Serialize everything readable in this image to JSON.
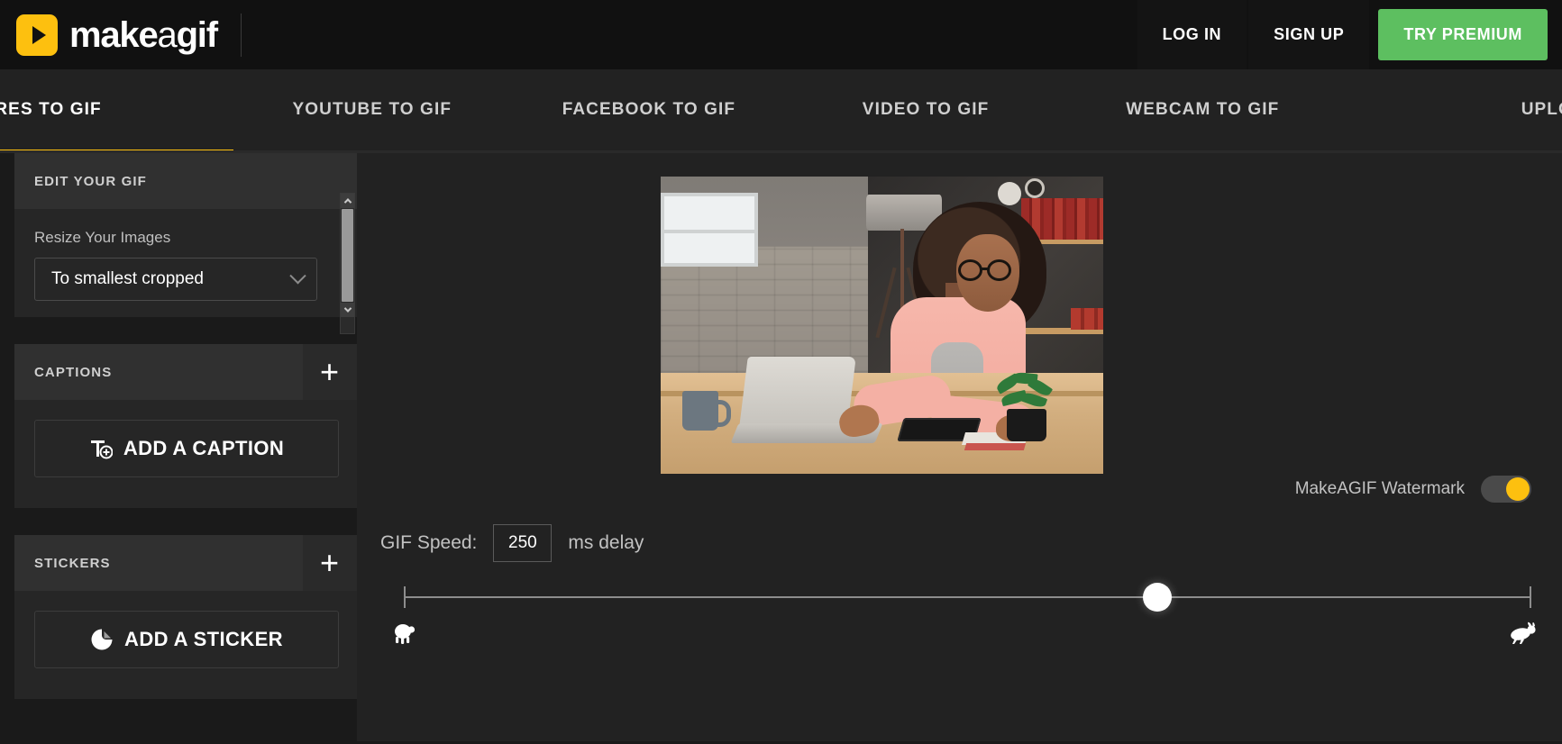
{
  "brand": {
    "logo_text_bold": "make",
    "logo_text_thin": "a",
    "logo_text_bold2": "gif",
    "play_icon": "play-arrow-icon"
  },
  "topnav": {
    "login": "LOG IN",
    "signup": "SIGN UP",
    "premium": "TRY PREMIUM",
    "premium_color": "#5DBF60"
  },
  "tabs": [
    {
      "label": "CTURES TO GIF",
      "active": true
    },
    {
      "label": "YOUTUBE TO GIF",
      "active": false
    },
    {
      "label": "FACEBOOK TO GIF",
      "active": false
    },
    {
      "label": "VIDEO TO GIF",
      "active": false
    },
    {
      "label": "WEBCAM TO GIF",
      "active": false
    },
    {
      "label": "UPLOAD A",
      "active": false
    }
  ],
  "sidebar": {
    "edit_header": "EDIT YOUR GIF",
    "resize": {
      "label": "Resize Your Images",
      "value": "To smallest cropped",
      "chevron": "chevron-down-icon"
    },
    "captions": {
      "header": "CAPTIONS",
      "plus": "+",
      "button": "ADD A CAPTION",
      "icon": "text-add-icon"
    },
    "stickers": {
      "header": "STICKERS",
      "plus": "+",
      "button": "ADD A STICKER",
      "icon": "sticker-icon"
    }
  },
  "main": {
    "watermark": {
      "label": "MakeAGIF Watermark",
      "enabled": true,
      "accent": "#FDC00F"
    },
    "speed": {
      "label": "GIF Speed:",
      "value": "250",
      "unit": "ms delay",
      "slider_position_percent": 66.8,
      "slow_icon": "turtle-icon",
      "fast_icon": "rabbit-icon"
    }
  },
  "theme": {
    "page_bg": "#1a1a1a",
    "topbar_bg": "#111111",
    "tabbar_bg": "#222222",
    "accent_yellow": "#FDC00F"
  }
}
